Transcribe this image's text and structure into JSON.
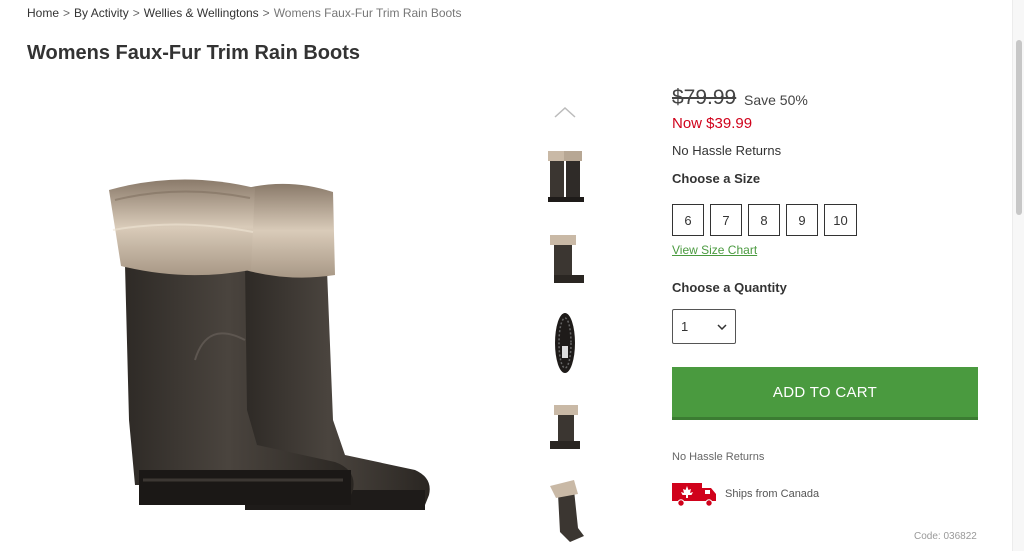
{
  "breadcrumb": {
    "home": "Home",
    "by_activity": "By Activity",
    "category": "Wellies & Wellingtons",
    "current": "Womens Faux-Fur Trim Rain Boots",
    "separator": ">"
  },
  "product": {
    "title": "Womens Faux-Fur Trim Rain Boots",
    "old_price": "$79.99",
    "save": "Save 50%",
    "now_price": "Now $39.99",
    "returns_top": "No Hassle Returns",
    "size_heading": "Choose a Size",
    "sizes": [
      "6",
      "7",
      "8",
      "9",
      "10"
    ],
    "size_chart": "View Size Chart",
    "quantity_heading": "Choose a Quantity",
    "quantity_value": "1",
    "add_to_cart": "ADD TO CART",
    "returns_bottom": "No Hassle Returns",
    "ships_from": "Ships from Canada",
    "code": "Code: 036822"
  },
  "colors": {
    "accent_green": "#4a9a3f",
    "sale_red": "#d0021b",
    "boot_body": "#3b3631",
    "fur": "#c9b9a6"
  },
  "icons": {
    "thumb_up": "chevron-up-icon",
    "qty": "chevron-down-icon",
    "shipping": "canada-truck-icon"
  }
}
